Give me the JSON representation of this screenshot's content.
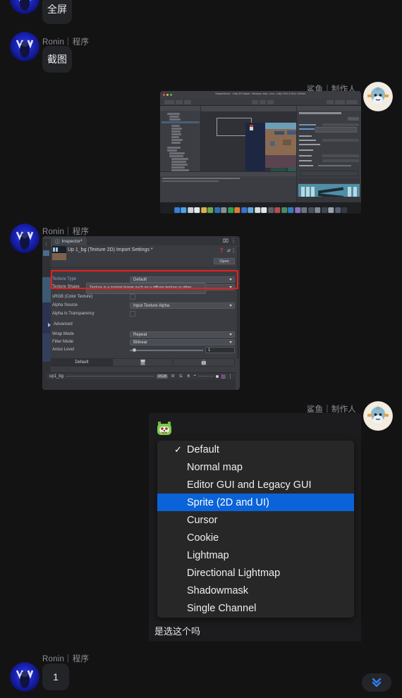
{
  "app": {
    "background": "#131314",
    "bubble_bg": "#232428",
    "accent_blue": "#0a63d8",
    "highlight_red": "#ee1c1c"
  },
  "messages": [
    {
      "id": "msg-fullscreen",
      "sender": "",
      "side": "left",
      "avatar_name": "ronin-avatar",
      "text": "全屏"
    },
    {
      "id": "msg-screenshot",
      "sender": "Ronin｜程序",
      "side": "left",
      "avatar_name": "ronin-avatar",
      "text": "截图"
    },
    {
      "id": "msg-unity-editor",
      "sender": "鲨鱼｜制作人",
      "side": "right",
      "avatar_name": "shark-avatar",
      "attachment": "unity-editor-screenshot"
    },
    {
      "id": "msg-inspector",
      "sender": "Ronin｜程序",
      "side": "left",
      "avatar_name": "ronin-avatar",
      "attachment": "unity-inspector-screenshot"
    },
    {
      "id": "msg-dropdown",
      "sender": "鲨鱼｜制作人",
      "side": "right",
      "avatar_name": "shark-avatar",
      "attachment": "texture-type-dropdown-screenshot",
      "caption": "是选这个吗"
    },
    {
      "id": "msg-one",
      "sender": "Ronin｜程序",
      "side": "left",
      "avatar_name": "ronin-avatar",
      "text": "1"
    }
  ],
  "unity_editor": {
    "window_title": "SampleScene - Unity 3D Default - Windows, Mac, Linux - Unity 2021.3.4f1c1 <Metal>",
    "dock_label": "macOS dock"
  },
  "inspector": {
    "tab_label": "Inspector*",
    "asset_title": "Up 1_bg (Texture 2D) Import Settings *",
    "open_button": "Open",
    "tooltip": "Texture is a normal image such as a diffuse texture or other.",
    "fields": [
      {
        "label": "Texture Type",
        "value": "Default",
        "type": "dropdown"
      },
      {
        "label": "Texture Shape",
        "value": "",
        "type": "dropdown"
      },
      {
        "label": "sRGB (Color Texture)",
        "value": "",
        "type": "checkbox"
      },
      {
        "label": "Alpha Source",
        "value": "Input Texture Alpha",
        "type": "dropdown"
      },
      {
        "label": "Alpha Is Transparency",
        "value": "",
        "type": "checkbox"
      },
      {
        "label": "Advanced",
        "value": "",
        "type": "foldout"
      },
      {
        "label": "Wrap Mode",
        "value": "Repeat",
        "type": "dropdown"
      },
      {
        "label": "Filter Mode",
        "value": "Bilinear",
        "type": "dropdown"
      },
      {
        "label": "Aniso Level",
        "value": "1",
        "type": "slider"
      }
    ],
    "platform_tabs": [
      "Default",
      "standalone-icon",
      "android-icon"
    ],
    "preview_name": "up1_bg",
    "preview_channels": [
      "RGB",
      "R",
      "G",
      "B"
    ]
  },
  "texture_type_menu": {
    "items": [
      {
        "label": "Default",
        "checked": true,
        "selected": false
      },
      {
        "label": "Normal map",
        "checked": false,
        "selected": false
      },
      {
        "label": "Editor GUI and Legacy GUI",
        "checked": false,
        "selected": false
      },
      {
        "label": "Sprite (2D and UI)",
        "checked": false,
        "selected": true
      },
      {
        "label": "Cursor",
        "checked": false,
        "selected": false
      },
      {
        "label": "Cookie",
        "checked": false,
        "selected": false
      },
      {
        "label": "Lightmap",
        "checked": false,
        "selected": false
      },
      {
        "label": "Directional Lightmap",
        "checked": false,
        "selected": false
      },
      {
        "label": "Shadowmask",
        "checked": false,
        "selected": false
      },
      {
        "label": "Single Channel",
        "checked": false,
        "selected": false
      }
    ],
    "check_glyph": "✓",
    "sticker_name": "green-cat-sticker"
  },
  "jump_to_latest": {
    "name": "scroll-to-bottom-button",
    "glyph": "chevrons-down-icon"
  }
}
